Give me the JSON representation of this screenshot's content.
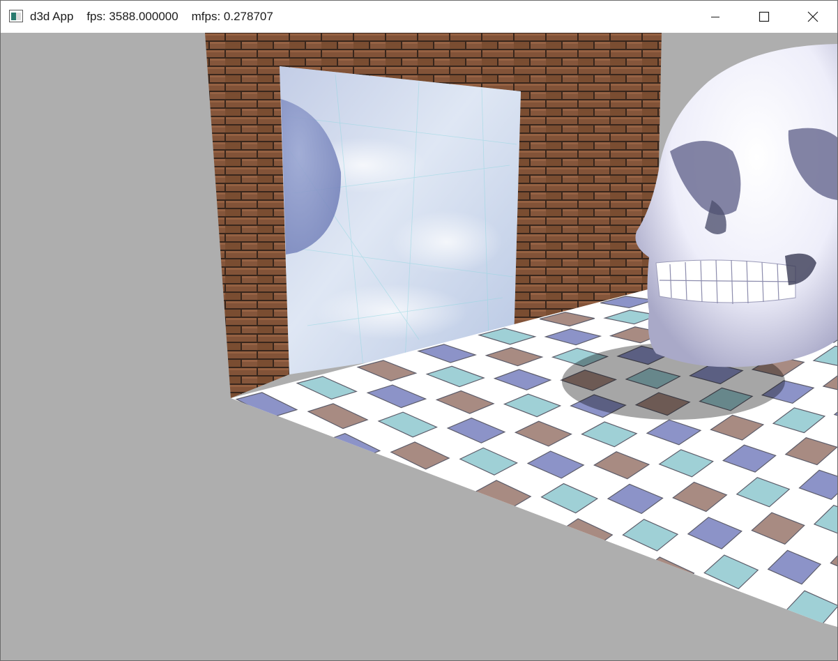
{
  "window": {
    "app_name": "d3d App",
    "fps_text": "fps: 3588.000000",
    "mfps_text": "mfps: 0.278707",
    "controls": {
      "minimize": "minimize-icon",
      "maximize": "maximize-icon",
      "close": "close-icon"
    }
  },
  "scene": {
    "background_color": "#aeaeae",
    "brick_color": "#8c5a3c",
    "mortar_color": "#3d2a1f",
    "mirror_color": "#c6d3e8",
    "skull_color": "#f2f2ff",
    "tile_colors": [
      "#8c93c8",
      "#9fd0d6",
      "#a88b82",
      "#ffffff"
    ]
  }
}
